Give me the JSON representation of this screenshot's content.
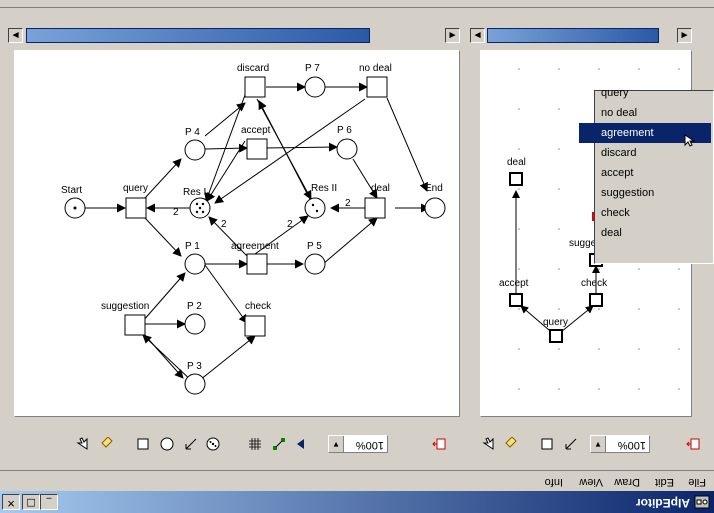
{
  "window": {
    "title": "AIpEditor",
    "btn_min": "_",
    "btn_max": "□",
    "btn_close": "✕"
  },
  "menu": {
    "file": "File",
    "edit": "Edit",
    "draw": "Draw",
    "view": "View",
    "info": "Info"
  },
  "left_toolbar": {
    "zoom": "100%"
  },
  "right_toolbar": {
    "zoom": "100%"
  },
  "net": {
    "places": {
      "start": "Start",
      "end": "End",
      "p1": "P 1",
      "p2": "P 2",
      "p3": "P 3",
      "p4": "P 4",
      "p5": "P 5",
      "p6": "P 6",
      "p7": "P 7",
      "res1": "Res I",
      "res2": "Res II"
    },
    "transitions": {
      "query": "query",
      "discard": "discard",
      "no_deal": "no deal",
      "accept": "accept",
      "agreement": "agreement",
      "deal": "deal",
      "suggestion": "suggestion",
      "check": "check"
    },
    "weights": {
      "w1": "2",
      "w2": "2",
      "w3": "2",
      "w4": "2"
    }
  },
  "graph": {
    "deal": "deal",
    "accept": "accept",
    "query": "query",
    "check": "check",
    "suggestion": "suggestion"
  },
  "context_menu": {
    "items": [
      "query",
      "no deal",
      "agreement",
      "discard",
      "accept",
      "suggestion",
      "check",
      "deal"
    ],
    "selected": "agreement"
  }
}
